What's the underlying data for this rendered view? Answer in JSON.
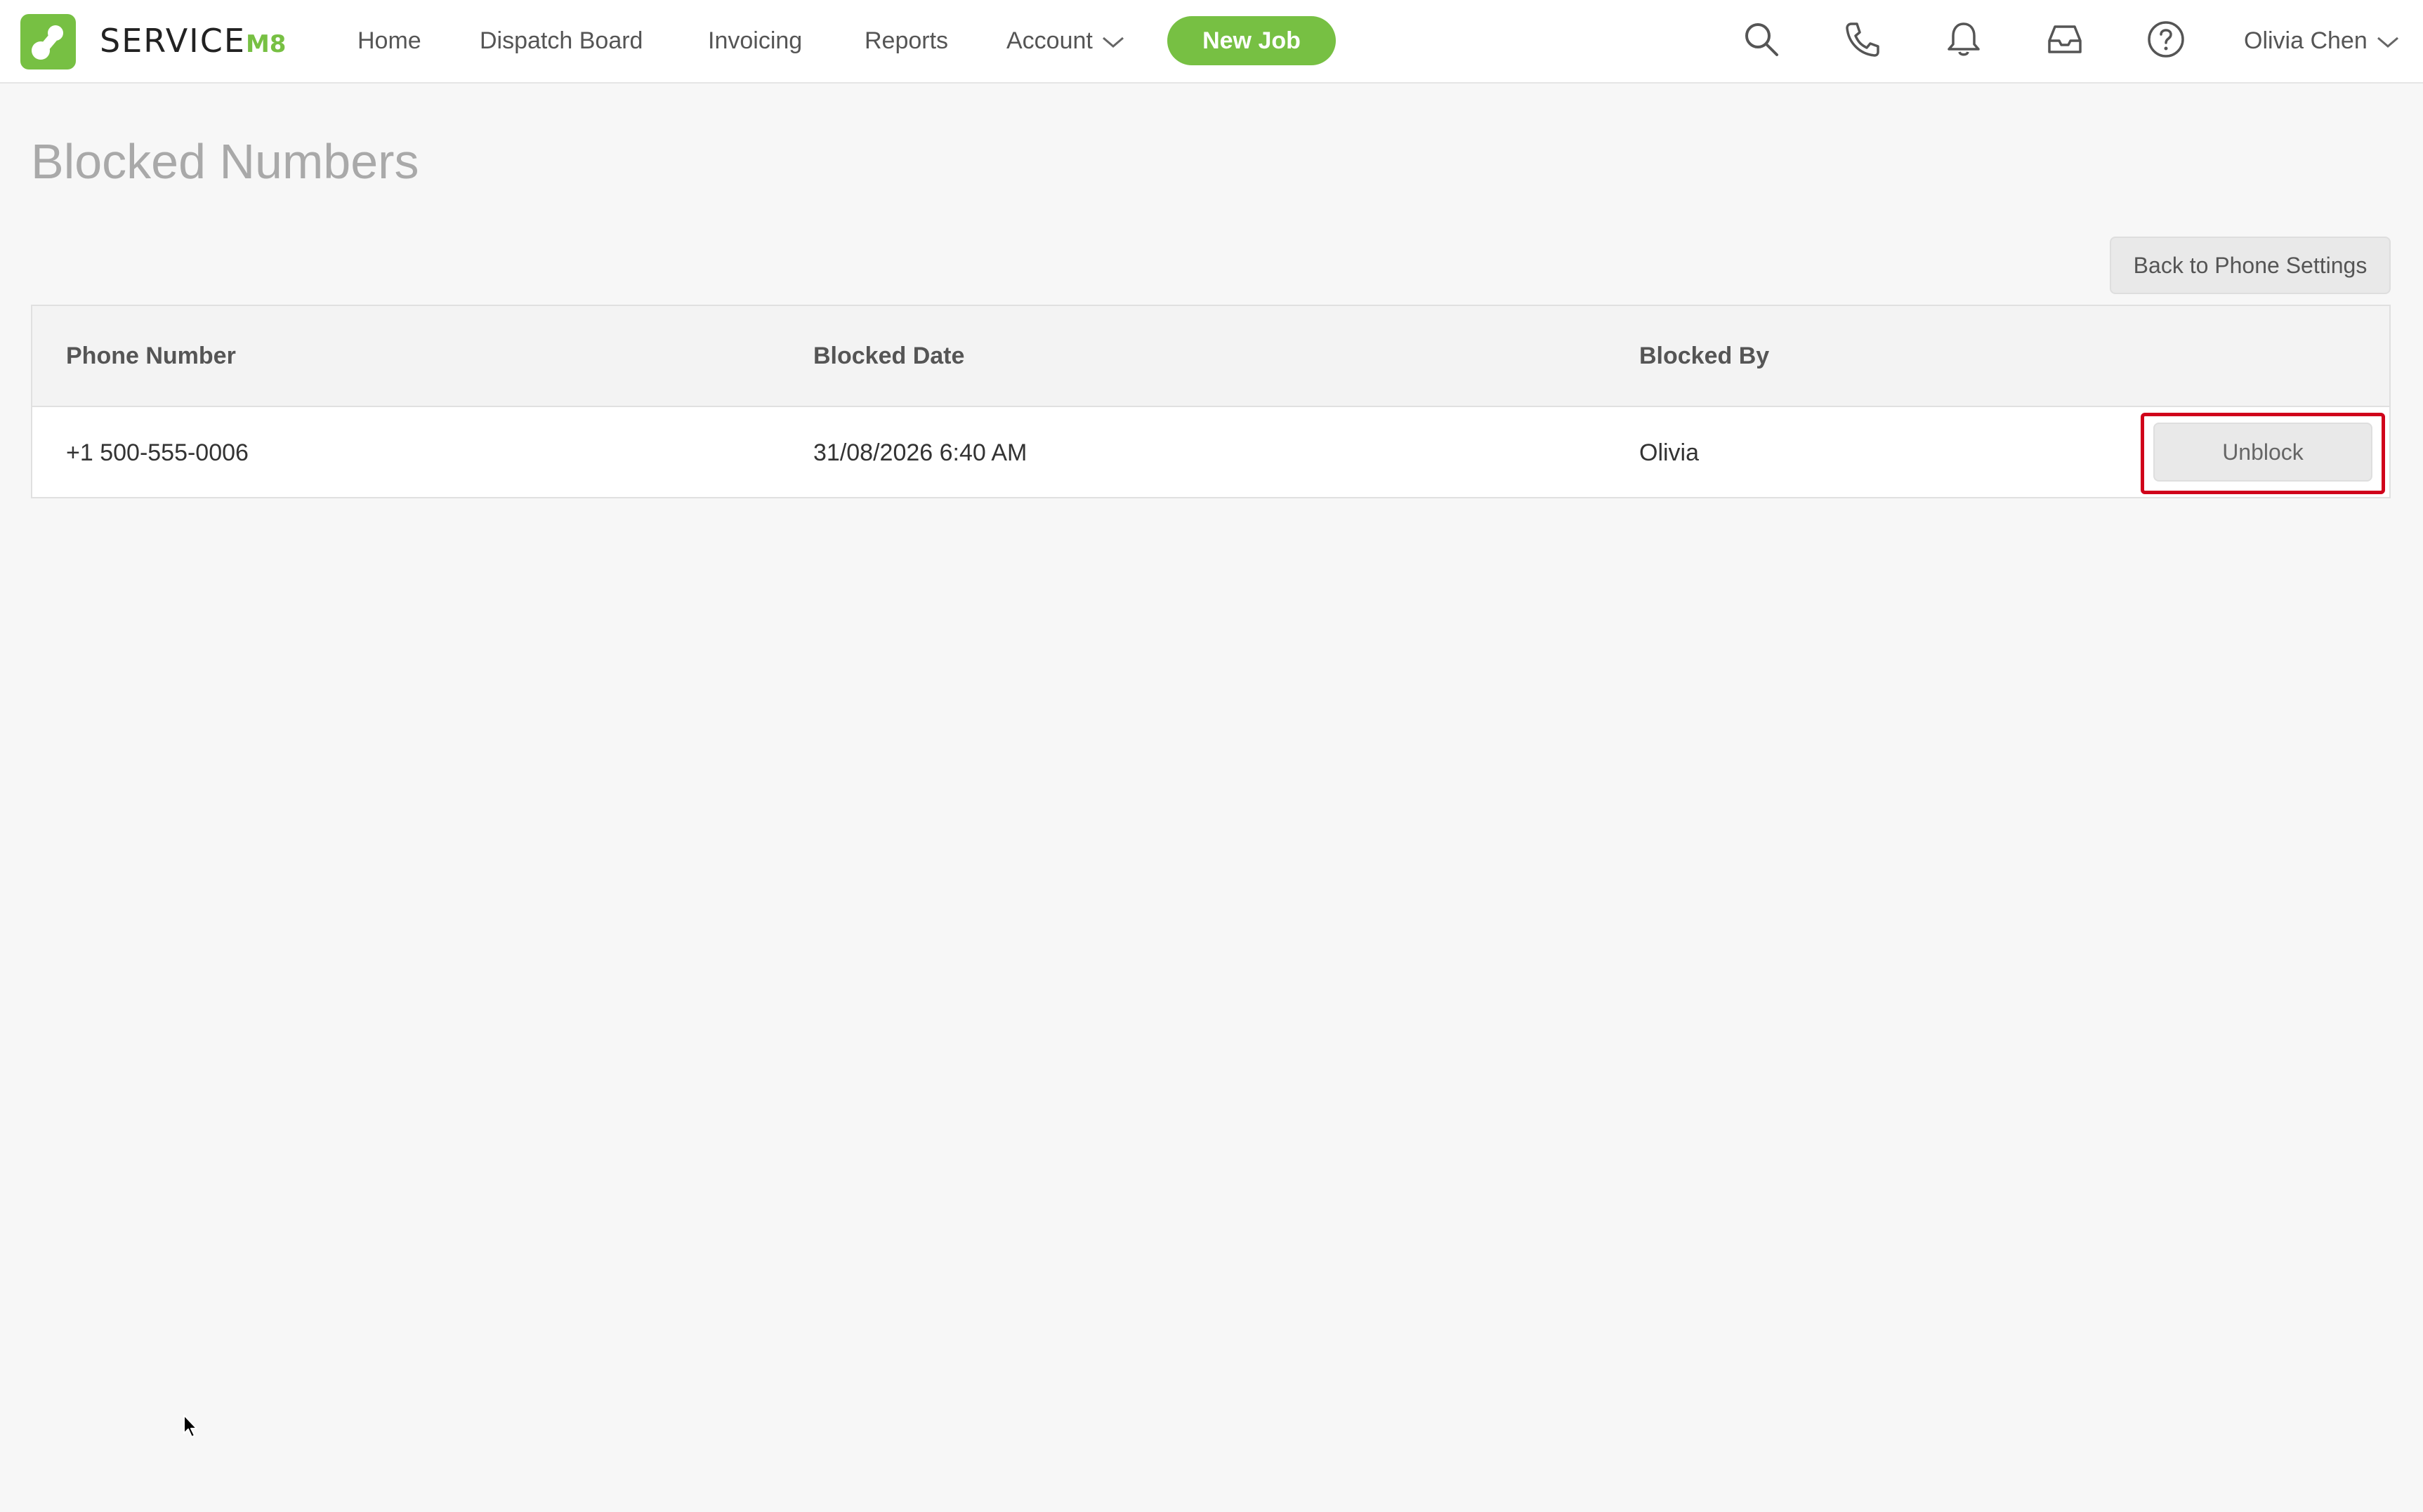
{
  "brand": {
    "word": "SERVICE",
    "suffix": "M8",
    "accent": "#77c043"
  },
  "nav": {
    "home": "Home",
    "dispatch_board": "Dispatch Board",
    "invoicing": "Invoicing",
    "reports": "Reports",
    "account": "Account",
    "new_job": "New Job"
  },
  "toolbar_icons": [
    "search-icon",
    "phone-icon",
    "bell-icon",
    "inbox-icon",
    "help-icon"
  ],
  "user": {
    "name": "Olivia Chen"
  },
  "page": {
    "title": "Blocked Numbers",
    "back_button": "Back to Phone Settings"
  },
  "table": {
    "columns": [
      "Phone Number",
      "Blocked Date",
      "Blocked By"
    ],
    "rows": [
      {
        "phone": "+1 500-555-0006",
        "date": "31/08/2026 6:40 AM",
        "by": "Olivia",
        "action": "Unblock"
      }
    ]
  },
  "highlight_color": "#d0021b"
}
